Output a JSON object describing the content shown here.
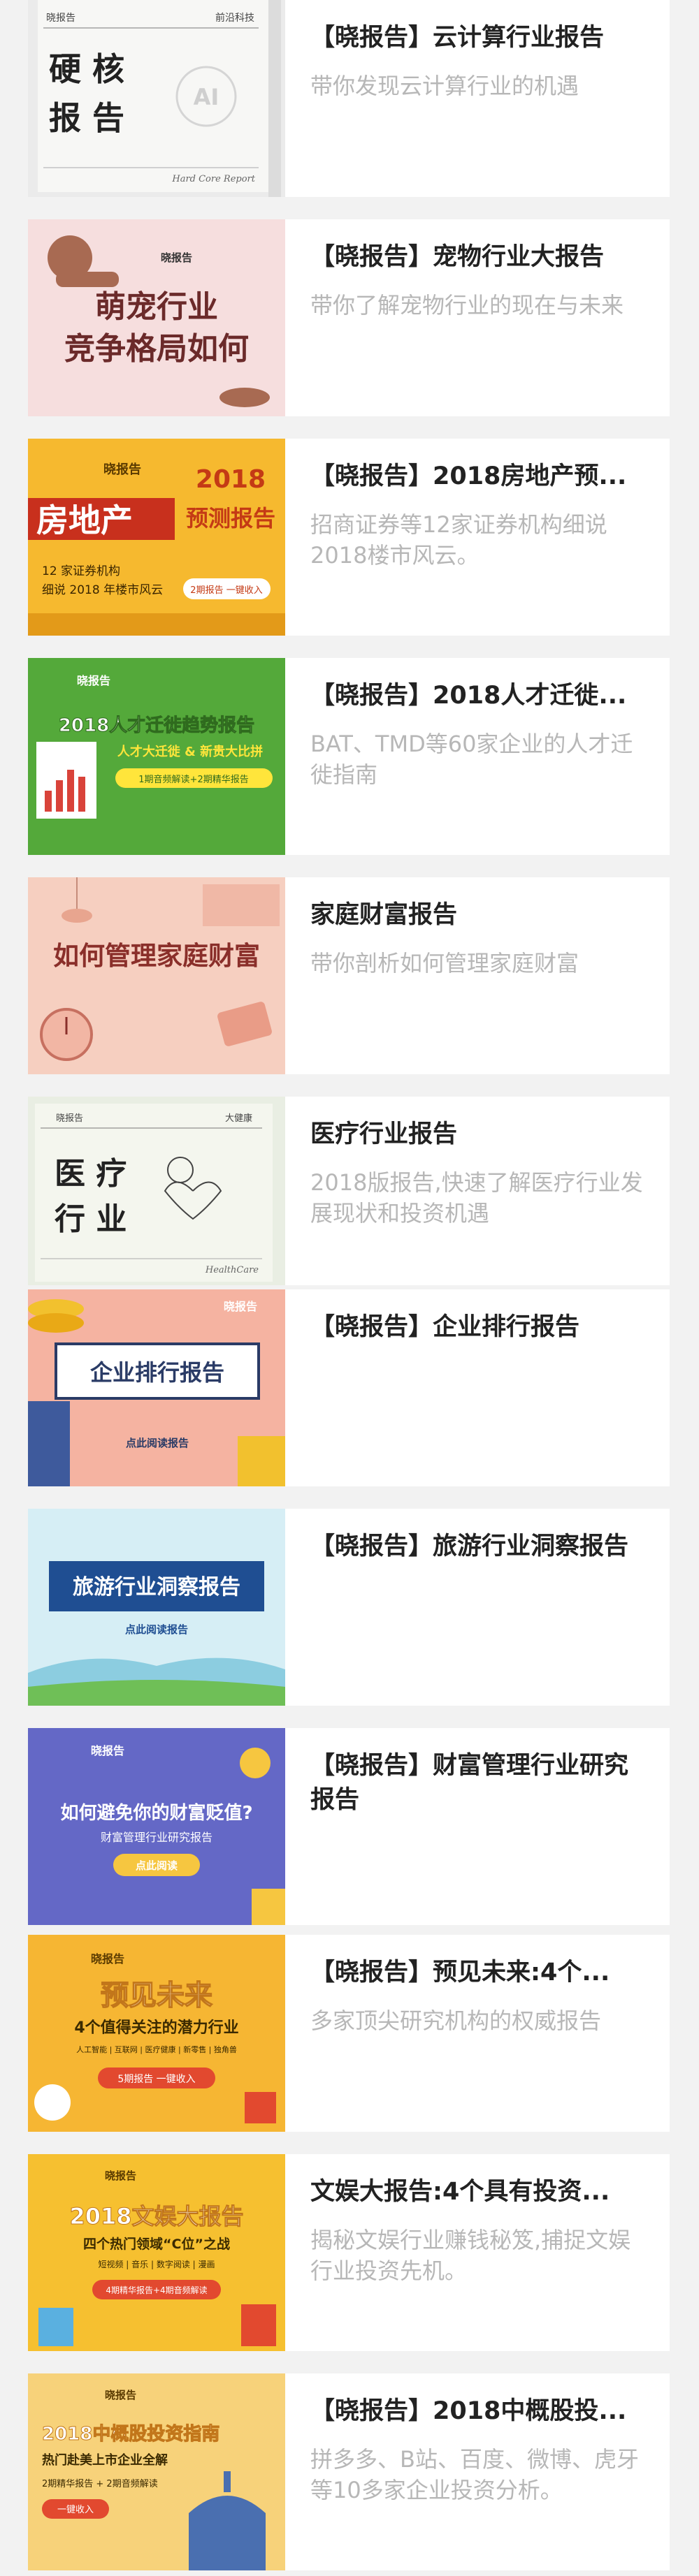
{
  "items": [
    {
      "title": "【晓报告】云计算行业报告",
      "desc": "带你发现云计算行业的机遇",
      "thumb": {
        "tag_left": "晓报告",
        "tag_right": "前沿科技",
        "big1": "硬 核",
        "big2": "报 告",
        "badge": "AI",
        "footer": "Hard Core Report"
      }
    },
    {
      "title": "【晓报告】宠物行业大报告",
      "desc": "带你了解宠物行业的现在与未来",
      "thumb": {
        "brand": "晓报告",
        "line1": "萌宠行业",
        "line2": "竞争格局如何"
      }
    },
    {
      "title": "【晓报告】2018房地产预...",
      "desc": "招商证券等12家证券机构细说2018楼市风云。",
      "thumb": {
        "brand": "晓报告",
        "year": "2018",
        "big": "房地产",
        "sub": "预测报告",
        "line1": "12 家证券机构",
        "line2": "细说 2018 年楼市风云",
        "cta": "2期报告 一键收入"
      }
    },
    {
      "title": "【晓报告】2018人才迁徙...",
      "desc": "BAT、TMD等60家企业的人才迁徙指南",
      "thumb": {
        "brand": "晓报告",
        "headline": "2018人才迁徙趋势报告",
        "sub": "人才大迁徙 & 新贵大比拼",
        "cta": "1期音频解读+2期精华报告"
      }
    },
    {
      "title": "家庭财富报告",
      "desc": "带你剖析如何管理家庭财富",
      "thumb": {
        "headline": "如何管理家庭财富"
      }
    },
    {
      "title": "医疗行业报告",
      "desc": "2018版报告,快速了解医疗行业发展现状和投资机遇",
      "thumb": {
        "tag_left": "晓报告",
        "tag_right": "大健康",
        "big1": "医 疗",
        "big2": "行 业",
        "footer": "HealthCare"
      }
    },
    {
      "title": "【晓报告】企业排行报告",
      "desc": "",
      "thumb": {
        "brand": "晓报告",
        "headline": "企业排行报告",
        "cta": "点此阅读报告"
      }
    },
    {
      "title": "【晓报告】旅游行业洞察报告",
      "desc": "",
      "thumb": {
        "headline": "旅游行业洞察报告",
        "cta": "点此阅读报告"
      }
    },
    {
      "title": "【晓报告】财富管理行业研究报告",
      "desc": "",
      "thumb": {
        "brand": "晓报告",
        "headline": "如何避免你的财富贬值?",
        "sub": "财富管理行业研究报告",
        "cta": "点此阅读"
      }
    },
    {
      "title": "【晓报告】预见未来:4个...",
      "desc": "多家顶尖研究机构的权威报告",
      "thumb": {
        "brand": "晓报告",
        "big": "预见未来",
        "sub": "4个值得关注的潜力行业",
        "tags": "人工智能 | 互联网 | 医疗健康 | 新零售 | 独角兽",
        "cta": "5期报告 一键收入"
      }
    },
    {
      "title": "文娱大报告:4个具有投资...",
      "desc": "揭秘文娱行业赚钱秘笈,捕捉文娱行业投资先机。",
      "thumb": {
        "brand": "晓报告",
        "headline": "2018文娱大报告",
        "sub": "四个热门领域“C位”之战",
        "tags": "短视频 | 音乐 | 数字阅读 | 漫画",
        "cta": "4期精华报告+4期音频解读"
      }
    },
    {
      "title": "【晓报告】2018中概股投...",
      "desc": "拼多多、B站、百度、微博、虎牙等10多家企业投资分析。",
      "thumb": {
        "brand": "晓报告",
        "headline": "2018中概股投资指南",
        "sub": "热门赴美上市企业全解",
        "line": "2期精华报告 + 2期音频解读",
        "cta": "一键收入"
      }
    }
  ],
  "colors": {
    "title": "#222222",
    "desc": "#b7b7b7",
    "bg": "#f2f2f2",
    "card": "#ffffff"
  }
}
